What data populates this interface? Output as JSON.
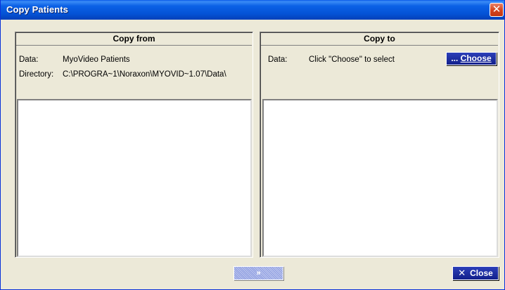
{
  "window": {
    "title": "Copy Patients",
    "close_glyph": "✕"
  },
  "copy_from": {
    "header": "Copy from",
    "data_label": "Data:",
    "data_value": "MyoVideo Patients",
    "directory_label": "Directory:",
    "directory_value": "C:\\PROGRA~1\\Noraxon\\MYOVID~1.07\\Data\\"
  },
  "copy_to": {
    "header": "Copy to",
    "data_label": "Data:",
    "data_value": "Click \"Choose\" to select",
    "choose_prefix": "... ",
    "choose_label": "Choose"
  },
  "footer": {
    "copy_glyph": "»",
    "close_glyph": "✕",
    "close_label": "Close"
  },
  "colors": {
    "titlebar": "#0453d6",
    "button_blue": "#12208c",
    "window_face": "#ece9d8"
  }
}
